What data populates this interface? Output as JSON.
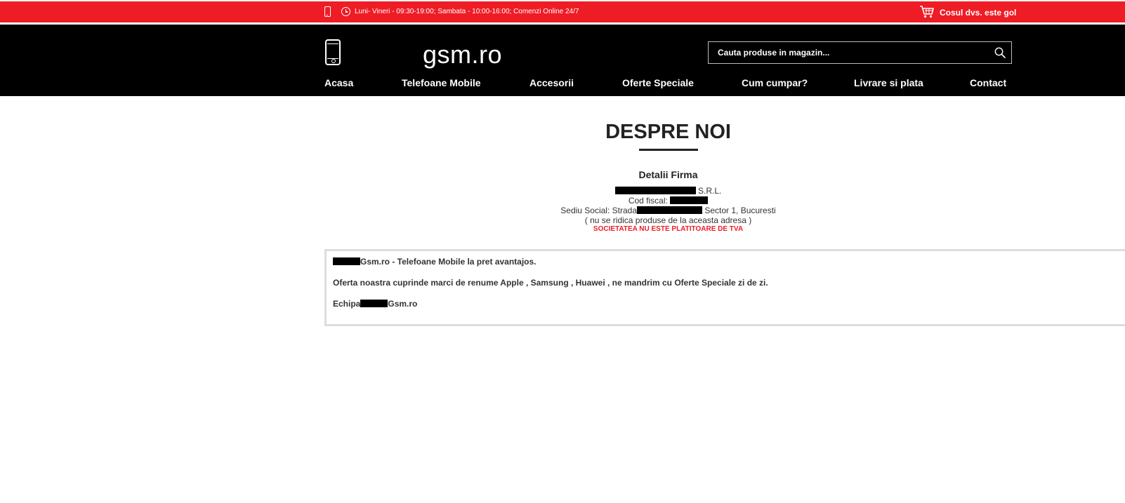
{
  "topbar": {
    "hours": "Luni- Vineri - 09:30-19:00; Sambata - 10:00-16:00; Comenzi Online 24/7",
    "cart_text": "Cosul dvs. este gol"
  },
  "header": {
    "logo_text": "gsm.ro",
    "search_placeholder": "Cauta produse in magazin..."
  },
  "nav": {
    "items": [
      "Acasa",
      "Telefoane Mobile",
      "Accesorii",
      "Oferte Speciale",
      "Cum cumpar?",
      "Livrare si plata",
      "Contact"
    ]
  },
  "about": {
    "title": "DESPRE NOI",
    "company_heading": "Detalii Firma",
    "company_suffix": "S.R.L.",
    "fiscal_code_label": "Cod fiscal:",
    "office_prefix": "Sediu Social: Strada",
    "office_suffix": "Sector 1, Bucuresti",
    "pickup_note": "( nu se ridica produse de la aceasta adresa )",
    "vat_note": "SOCIETATEA NU ESTE PLATITOARE DE TVA"
  },
  "content": {
    "line1_suffix": "Gsm.ro - Telefoane Mobile la pret avantajos.",
    "line2": "Oferta noastra cuprinde marci de renume Apple , Samsung , Huawei , ne mandrim cu Oferte Speciale zi de zi.",
    "line3_prefix": "Echipa",
    "line3_suffix": "Gsm.ro"
  }
}
